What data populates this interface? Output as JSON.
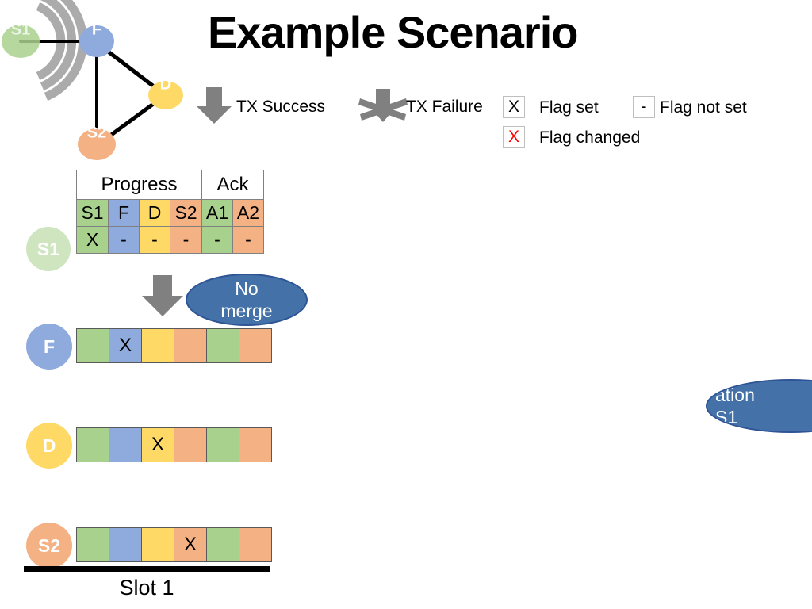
{
  "title": "Example Scenario",
  "topology": {
    "nodes": [
      {
        "id": "S1",
        "label": "S1",
        "color": "#A9D18E"
      },
      {
        "id": "F",
        "label": "F",
        "color": "#8FAADC"
      },
      {
        "id": "D",
        "label": "D",
        "color": "#FFD966"
      },
      {
        "id": "S2",
        "label": "S2",
        "color": "#F4B183"
      }
    ],
    "edges": [
      [
        "S1",
        "F"
      ],
      [
        "F",
        "D"
      ],
      [
        "F",
        "S2"
      ],
      [
        "D",
        "S2"
      ]
    ],
    "transmitting_node": "S1"
  },
  "legend": {
    "tx_success": "TX Success",
    "tx_failure": "TX Failure",
    "flag_set": "Flag set",
    "flag_set_symbol": "X",
    "flag_not_set": "Flag not set",
    "flag_not_set_symbol": "-",
    "flag_changed": "Flag changed",
    "flag_changed_symbol": "X"
  },
  "table": {
    "group_headers": [
      {
        "label": "Progress",
        "span": 4
      },
      {
        "label": "Ack",
        "span": 2
      }
    ],
    "columns": [
      "S1",
      "F",
      "D",
      "S2",
      "A1",
      "A2"
    ],
    "column_colors": [
      "#A9D18E",
      "#8FAADC",
      "#FFD966",
      "#F4B183",
      "#A9D18E",
      "#F4B183"
    ],
    "rows": [
      {
        "node": "S1",
        "values": [
          "X",
          "-",
          "-",
          "-",
          "-",
          "-"
        ]
      }
    ]
  },
  "slot_rows": [
    {
      "node": "F",
      "node_color": "#8FAADC",
      "values": [
        "",
        "X",
        "",
        "",
        "",
        ""
      ]
    },
    {
      "node": "D",
      "node_color": "#FFD966",
      "values": [
        "",
        "",
        "X",
        "",
        "",
        ""
      ]
    },
    {
      "node": "S2",
      "node_color": "#F4B183",
      "values": [
        "",
        "",
        "",
        "X",
        "",
        ""
      ]
    }
  ],
  "slot_cell_colors": [
    "#A9D18E",
    "#8FAADC",
    "#FFD966",
    "#F4B183",
    "#A9D18E",
    "#F4B183"
  ],
  "callouts": [
    {
      "id": "no-merge",
      "line1": "No",
      "line2": "merge"
    },
    {
      "id": "duplication-s1",
      "line1": "ation",
      "line2": "S1"
    }
  ],
  "slot_label": "Slot 1",
  "colors": {
    "green": "#A9D18E",
    "blue": "#8FAADC",
    "yellow": "#FFD966",
    "orange": "#F4B183",
    "callout_fill": "#4472A8",
    "arrow_gray": "#808080",
    "wave_gray": "#ABABAB"
  }
}
